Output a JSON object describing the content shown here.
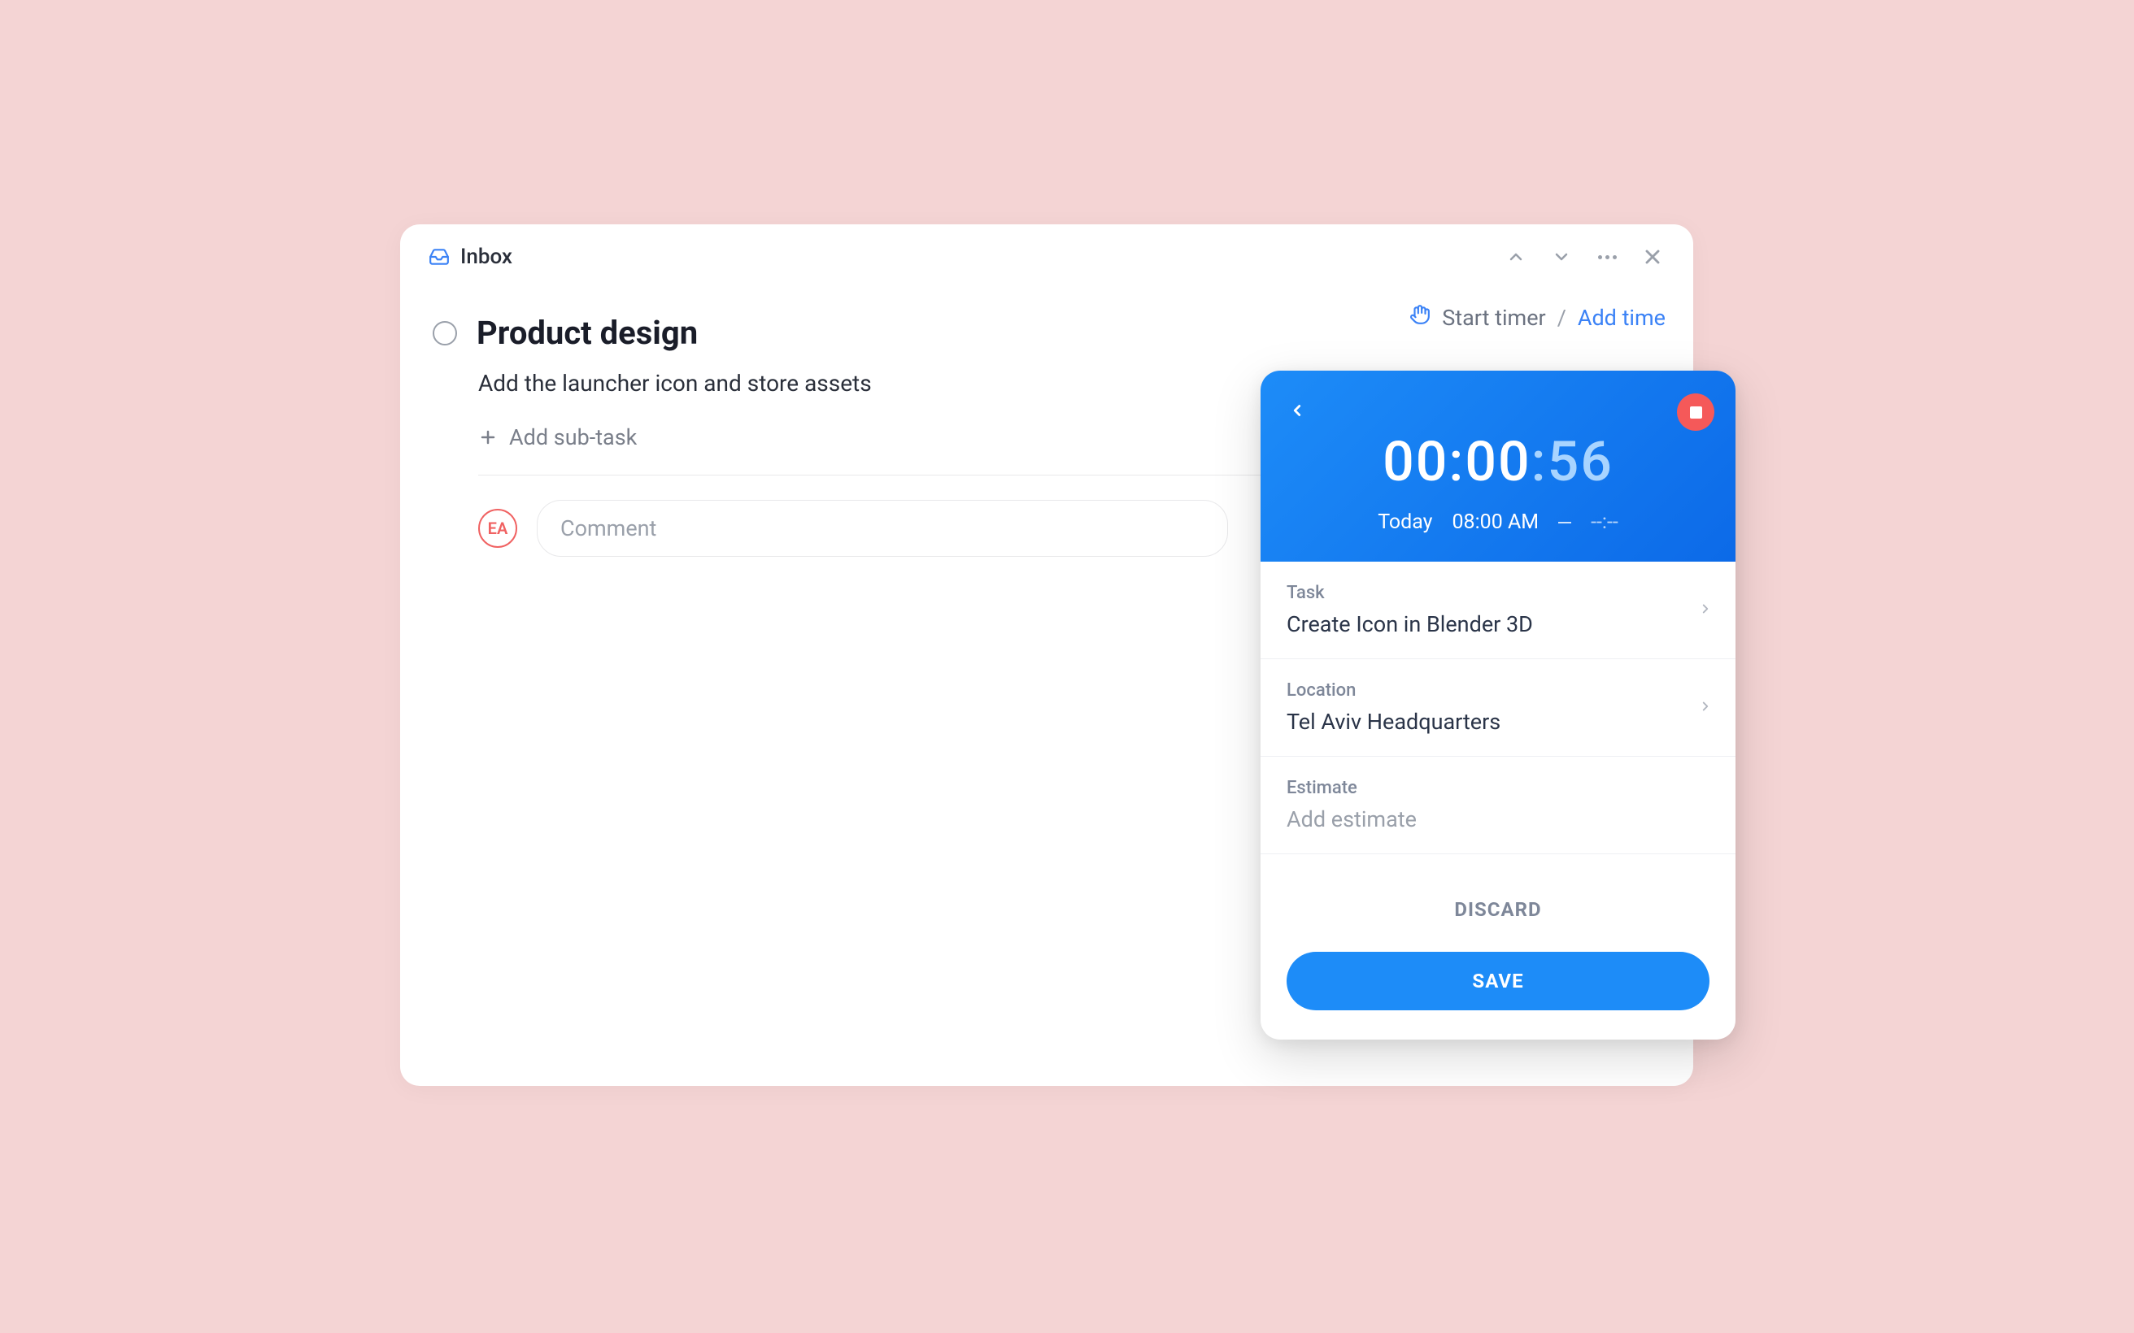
{
  "header": {
    "inbox_label": "Inbox"
  },
  "task": {
    "title": "Product design",
    "description": "Add the launcher icon and store assets",
    "add_subtask_label": "Add sub-task",
    "avatar_initials": "EA",
    "comment_placeholder": "Comment"
  },
  "timer_bar": {
    "start_label": "Start timer",
    "separator": "/",
    "add_label": "Add time"
  },
  "timer": {
    "hh": "00",
    "mm": "00",
    "ss": "56",
    "colon": ":",
    "day": "Today",
    "start_time": "08:00 AM",
    "end_time": "--:--",
    "task_label": "Task",
    "task_value": "Create Icon in Blender 3D",
    "location_label": "Location",
    "location_value": "Tel Aviv Headquarters",
    "estimate_label": "Estimate",
    "estimate_placeholder": "Add estimate",
    "discard_label": "DISCARD",
    "save_label": "SAVE"
  }
}
